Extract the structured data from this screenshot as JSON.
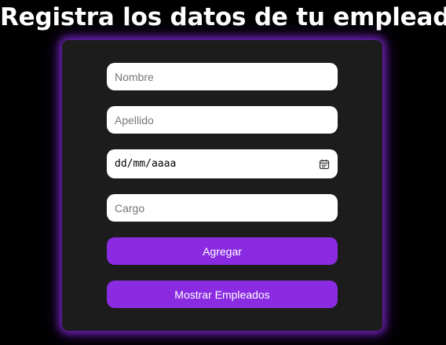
{
  "header": {
    "title": "Registra los datos de tu empleado"
  },
  "form": {
    "nombre_placeholder": "Nombre",
    "apellido_placeholder": "Apellido",
    "fecha_placeholder": "dd/mm/aaaa",
    "cargo_placeholder": "Cargo",
    "agregar_label": "Agregar",
    "mostrar_label": "Mostrar Empleados"
  },
  "icons": {
    "date_picker": "calendar-icon"
  },
  "colors": {
    "background": "#000000",
    "card": "#1c1c1c",
    "accent": "#8a2be2",
    "glow": "#8a2be2",
    "input_bg": "#ffffff",
    "placeholder": "#777777"
  }
}
